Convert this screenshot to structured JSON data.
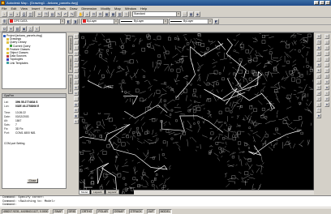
{
  "window": {
    "title": "Autodesk Map - [Drawing1 - Ankara_parcels.dwg]"
  },
  "menu": [
    "File",
    "Edit",
    "View",
    "Insert",
    "Format",
    "Tools",
    "Draw",
    "Dimension",
    "Modify",
    "Map",
    "Window",
    "Help"
  ],
  "toolbar": {
    "layer_combo": "GPS DATA",
    "layer_color_hex": "#e02020",
    "style_combo": "Standard",
    "color_combo": "ByLayer",
    "linetype_combo": "ByLayer",
    "lineweight_combo": "ByLayer"
  },
  "tree": {
    "items": [
      {
        "label": "Project [ankara_parcels.dwg]",
        "indent": 0,
        "icon_color": "#3060c0"
      },
      {
        "label": "Drawings",
        "indent": 1,
        "icon_color": "#e0c040"
      },
      {
        "label": "Query Library",
        "indent": 1,
        "icon_color": "#e0c040"
      },
      {
        "label": "Current Query",
        "indent": 2,
        "icon_color": "#40a040"
      },
      {
        "label": "Feature Classes",
        "indent": 1,
        "icon_color": "#e0c040"
      },
      {
        "label": "Object Classes",
        "indent": 1,
        "icon_color": "#e0c040"
      },
      {
        "label": "Data Sources",
        "indent": 1,
        "icon_color": "#c04040"
      },
      {
        "label": "Topologies",
        "indent": 1,
        "icon_color": "#4040c0"
      },
      {
        "label": "Link Templates",
        "indent": 1,
        "icon_color": "#40a0a0"
      }
    ]
  },
  "gps": {
    "header": "GpsFrm",
    "lat_label": "Lat:",
    "lat_value": "39N 55.2774634 S",
    "lon_label": "Lon:",
    "lon_value": "032E 49.2753006 E",
    "fields": [
      {
        "k": "Time:",
        "v": "13:26:22"
      },
      {
        "k": "Date:",
        "v": "03/12/2003"
      },
      {
        "k": "Alt:",
        "v": "1847"
      },
      {
        "k": "Sats:",
        "v": "7"
      },
      {
        "k": "Fix:",
        "v": "3D Fix"
      },
      {
        "k": "Port:",
        "v": "COM1 4800 N81"
      }
    ],
    "extra": "COM port Setting",
    "close_label": "Close"
  },
  "side_tabs": [
    "Workspace",
    "Properties",
    "Tool Palettes"
  ],
  "layout_tabs": [
    "Model",
    "Layout1",
    "Layout2"
  ],
  "command_lines": [
    "Command: Specify corner:",
    "Command: <Switching to: Model>",
    "Command:"
  ],
  "status": {
    "coords": "458217.9231, 4419843.1127, 0.0000",
    "toggles": [
      "SNAP",
      "GRID",
      "ORTHO",
      "POLAR",
      "OSNAP",
      "OTRACK",
      "LWT",
      "MODEL"
    ]
  }
}
